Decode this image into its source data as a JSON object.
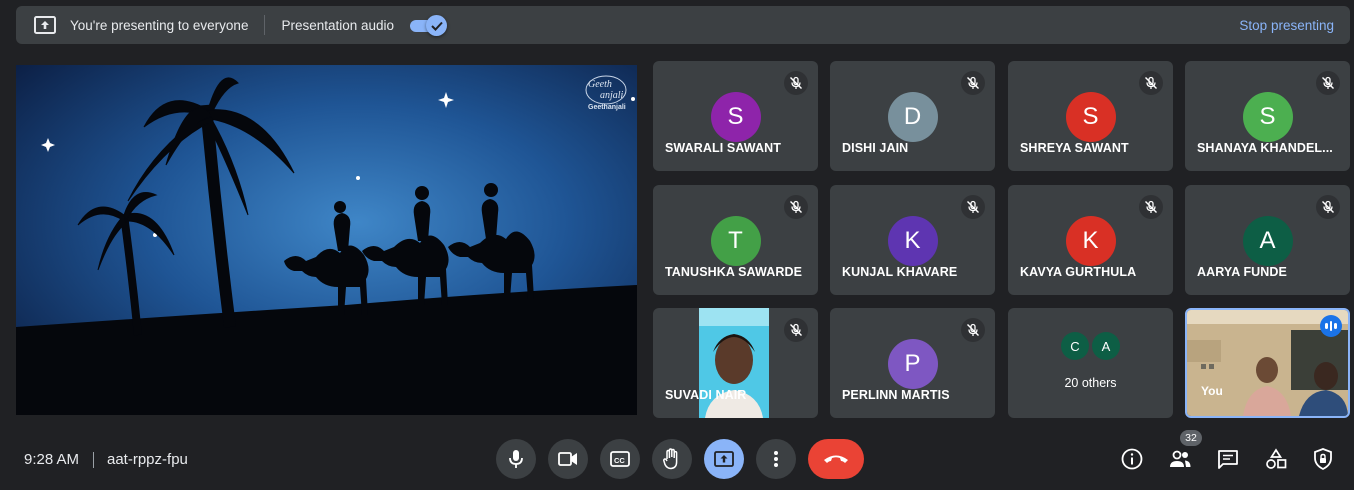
{
  "banner": {
    "presenting_text": "You're presenting to everyone",
    "audio_label": "Presentation audio",
    "audio_enabled": true,
    "stop_label": "Stop presenting"
  },
  "presentation": {
    "watermark_line1": "Geeth",
    "watermark_line2": "anjali",
    "watermark_caption": "Geethanjali"
  },
  "participants": [
    {
      "name": "SWARALI SAWANT",
      "initial": "S",
      "color": "#8e24aa"
    },
    {
      "name": "DISHI JAIN",
      "initial": "D",
      "color": "#78909c"
    },
    {
      "name": "SHREYA SAWANT",
      "initial": "S",
      "color": "#d93025"
    },
    {
      "name": "SHANAYA KHANDEL...",
      "initial": "S",
      "color": "#4caf50"
    },
    {
      "name": "TANUSHKA SAWARDE",
      "initial": "T",
      "color": "#43a047"
    },
    {
      "name": "KUNJAL KHAVARE",
      "initial": "K",
      "color": "#5e35b1"
    },
    {
      "name": "KAVYA GURTHULA",
      "initial": "K",
      "color": "#d93025"
    },
    {
      "name": "AARYA FUNDE",
      "initial": "A",
      "color": "#0d5e45"
    },
    {
      "name": "SUVADI NAIR",
      "initial": "",
      "color": "#3c4043"
    },
    {
      "name": "PERLINN MARTIS",
      "initial": "P",
      "color": "#7e57c2"
    }
  ],
  "others": {
    "avatars": [
      {
        "initial": "C",
        "color": "#0d5e45"
      },
      {
        "initial": "A",
        "color": "#0d5e45"
      }
    ],
    "label": "20 others"
  },
  "self_tile": {
    "label": "You"
  },
  "footer": {
    "time": "9:28 AM",
    "meeting_code": "aat-rppz-fpu",
    "participant_count": "32"
  }
}
